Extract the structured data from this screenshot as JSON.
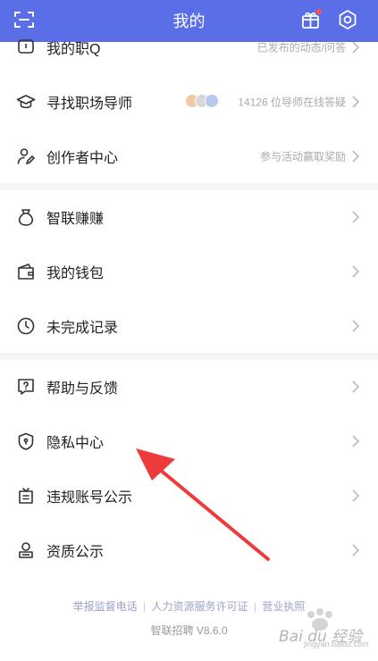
{
  "header": {
    "title": "我的",
    "icons": [
      "scan-icon",
      "gift-icon",
      "settings-icon"
    ]
  },
  "menu": [
    {
      "label": "我的职Q",
      "hint": "已发布的动态/问答",
      "icon": "chat-bubble-icon"
    },
    {
      "label": "寻找职场导师",
      "hint": "14126 位导师在线答疑",
      "icon": "graduation-cap-icon"
    },
    {
      "label": "创作者中心",
      "hint": "参与活动赢取奖励",
      "icon": "creator-icon"
    },
    {
      "label": "智联赚赚",
      "hint": "",
      "icon": "money-bag-icon"
    },
    {
      "label": "我的钱包",
      "hint": "",
      "icon": "wallet-icon"
    },
    {
      "label": "未完成记录",
      "hint": "",
      "icon": "clock-icon"
    },
    {
      "label": "帮助与反馈",
      "hint": "",
      "icon": "help-icon"
    },
    {
      "label": "隐私中心",
      "hint": "",
      "icon": "shield-icon"
    },
    {
      "label": "违规账号公示",
      "hint": "",
      "icon": "notice-icon"
    },
    {
      "label": "资质公示",
      "hint": "",
      "icon": "qualification-icon"
    }
  ],
  "footer": {
    "links": [
      "举报监督电话",
      "人力资源服务许可证",
      "营业执照"
    ],
    "separator": "|",
    "version": "智联招聘 V8.6.0"
  },
  "watermark": {
    "text": "Bai du 经验",
    "sub": "jingyan.baidu.com"
  },
  "colors": {
    "header_bg": "#5a6ee8",
    "arrow": "#ee3a3a",
    "section_gap": "#f5f6f8"
  }
}
